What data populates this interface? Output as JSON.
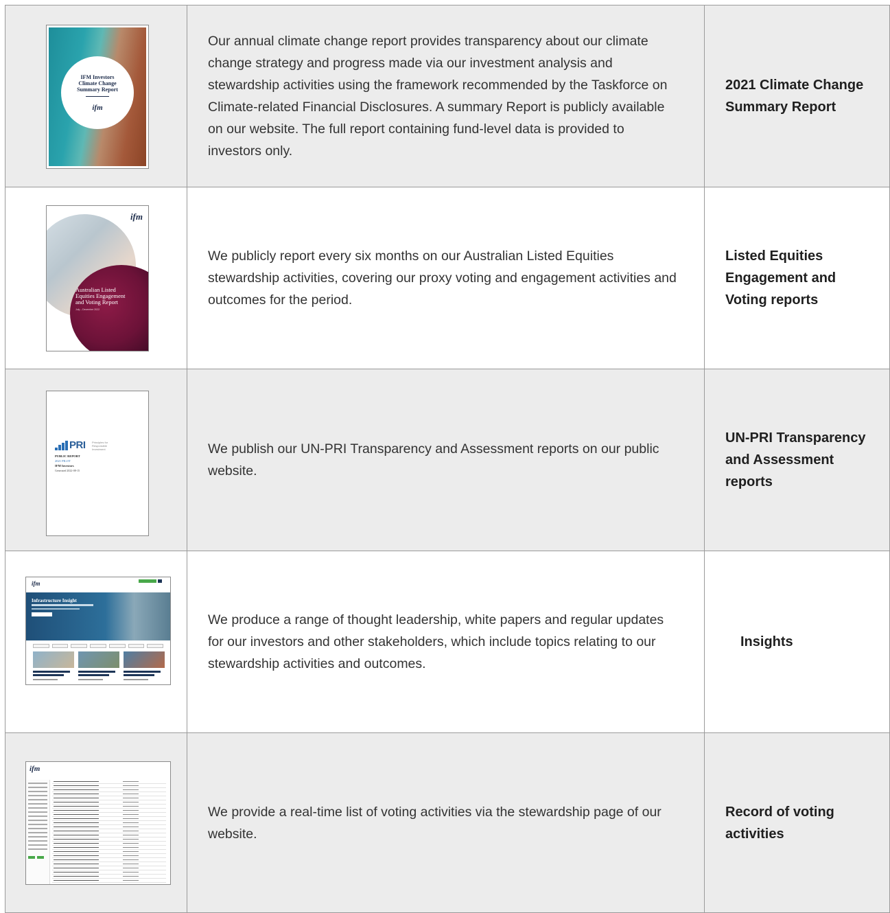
{
  "rows": [
    {
      "thumbnail": {
        "title_lines": [
          "IFM Investors",
          "Climate Change",
          "Summary Report"
        ],
        "logo": "ifm"
      },
      "description": "Our annual climate change report provides transparency about our climate change strategy and progress made via our investment analysis and stewardship activities using the framework recommended by the Taskforce on Climate-related Financial Disclosures. A summary Report is publicly available on our website. The full report containing fund-level data is provided to investors only.",
      "title": "2021 Climate Change Summary Report"
    },
    {
      "thumbnail": {
        "title_lines": [
          "Australian Listed",
          "Equities Engagement",
          "and Voting Report"
        ],
        "date": "July – December 2022",
        "logo": "ifm"
      },
      "description": "We publicly report every six months on our Australian Listed Equities stewardship activities, covering our proxy voting and engagement activities and outcomes for the period.",
      "title": "Listed Equities Engagement and Voting reports"
    },
    {
      "thumbnail": {
        "brand": "PRI",
        "brand_sub": "Principles for Responsible Investment",
        "line1": "PUBLIC REPORT",
        "line2": "2021 PILOT",
        "line3": "IFM Investors",
        "line4": "Generated 2022-08-15"
      },
      "description": "We publish our UN-PRI Transparency and Assessment reports on our public website.",
      "title": "UN-PRI Transparency and Assessment reports"
    },
    {
      "thumbnail": {
        "logo": "ifm",
        "hero_title": "Infrastructure Insight"
      },
      "description": "We produce a range of thought leadership, white papers and regular updates for our investors and other stakeholders, which include topics relating to our stewardship activities and outcomes.",
      "title": "Insights"
    },
    {
      "thumbnail": {
        "logo": "ifm"
      },
      "description": "We provide a real-time list of voting activities via the stewardship page of our website.",
      "title": "Record of voting activities"
    }
  ]
}
